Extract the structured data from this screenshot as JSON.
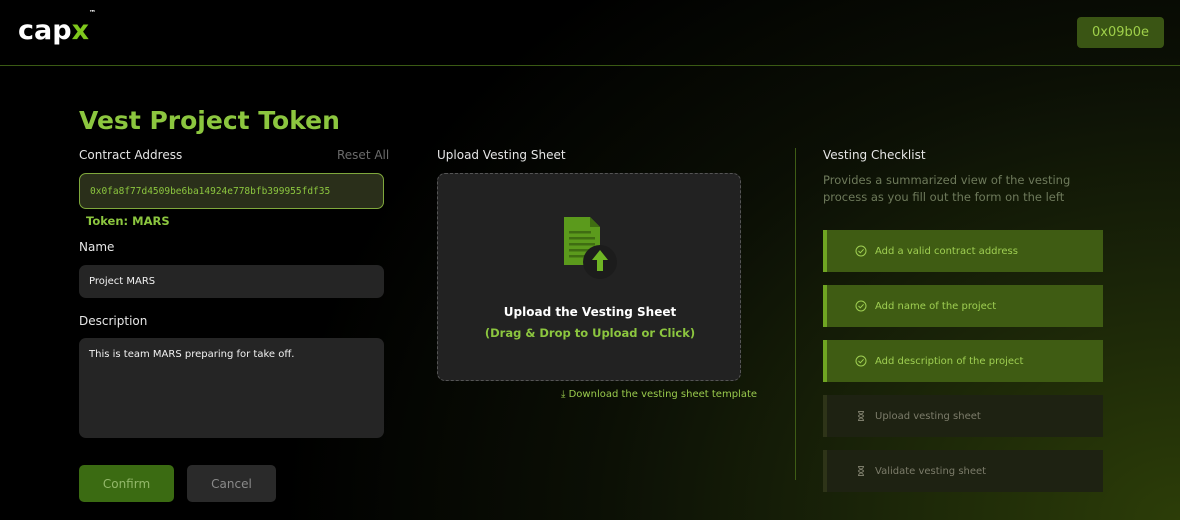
{
  "header": {
    "logo_text": "cap",
    "logo_x": "x",
    "logo_tm": "™",
    "wallet_label": "0x09b0e"
  },
  "form": {
    "title": "Vest Project Token",
    "contract_label": "Contract Address",
    "reset_label": "Reset All",
    "contract_value": "0x0fa8f77d4509be6ba14924e778bfb399955fdf35",
    "token_label": "Token: MARS",
    "name_label": "Name",
    "name_value": "Project MARS",
    "description_label": "Description",
    "description_value": "This is team MARS preparing for take off.",
    "confirm_label": "Confirm",
    "cancel_label": "Cancel"
  },
  "upload": {
    "section_label": "Upload Vesting Sheet",
    "title": "Upload the Vesting Sheet",
    "subtitle": "(Drag & Drop to Upload or Click)",
    "download_label": "Download the vesting sheet template",
    "icon": "file-upload-icon"
  },
  "checklist": {
    "title": "Vesting Checklist",
    "description": "Provides a summarized view of the vesting process as you fill out the form on the left",
    "items": [
      {
        "label": "Add a valid contract address",
        "status": "done",
        "icon": "check-circle-icon"
      },
      {
        "label": "Add name of the project",
        "status": "done",
        "icon": "check-circle-icon"
      },
      {
        "label": "Add description of the project",
        "status": "done",
        "icon": "check-circle-icon"
      },
      {
        "label": "Upload vesting sheet",
        "status": "pending",
        "icon": "hourglass-icon"
      },
      {
        "label": "Validate vesting sheet",
        "status": "pending",
        "icon": "hourglass-icon"
      }
    ]
  },
  "colors": {
    "accent": "#8cc63f",
    "accent_dark": "#3f5c13",
    "background": "#000000",
    "panel": "#252525"
  }
}
